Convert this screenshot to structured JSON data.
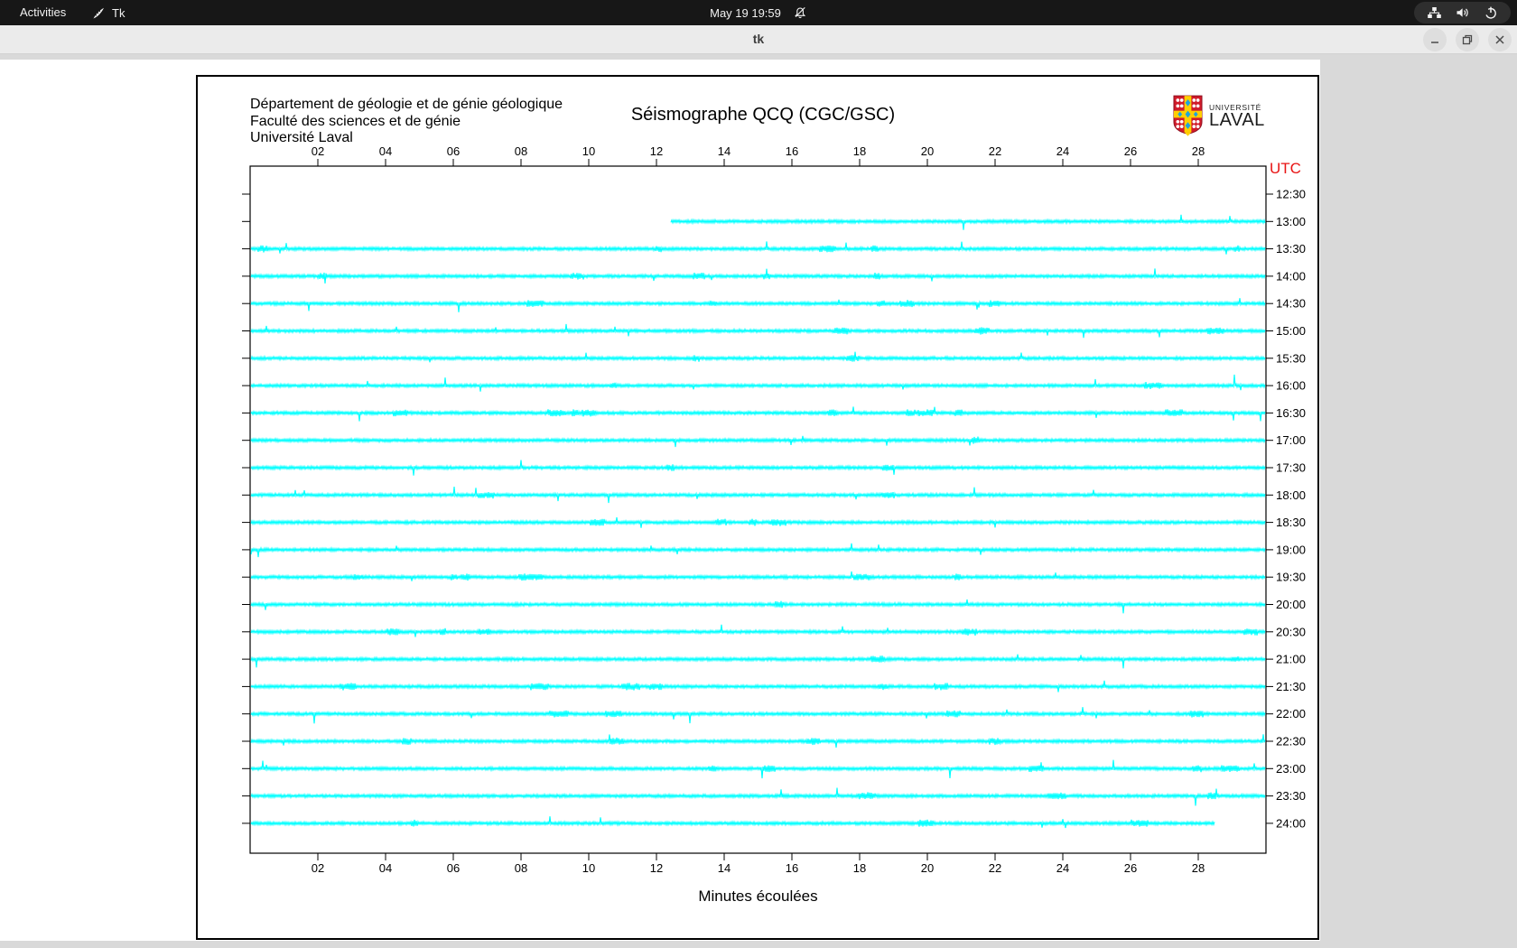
{
  "topbar": {
    "activities_label": "Activities",
    "app_name": "Tk",
    "clock": "May 19 19:59"
  },
  "titlebar": {
    "title": "tk"
  },
  "seismograph": {
    "institution_lines": [
      "Département de géologie et de génie géologique",
      "Faculté des sciences et de génie",
      "Université Laval"
    ],
    "title": "Séismographe QCQ (CGC/GSC)",
    "utc_label": "UTC",
    "utc_color": "#e81414",
    "xlabel": "Minutes écoulées",
    "logo": {
      "line1": "UNIVERSITÉ",
      "line2": "LAVAL",
      "shield_red": "#d01b2a",
      "shield_yellow": "#ffcf00",
      "shield_blue": "#1fa3dc"
    }
  },
  "chart_data": {
    "type": "line",
    "title": "Séismographe QCQ (CGC/GSC)",
    "xlabel": "Minutes écoulées",
    "x_range": [
      0,
      30
    ],
    "x_ticks": [
      "02",
      "04",
      "06",
      "08",
      "10",
      "12",
      "14",
      "16",
      "18",
      "20",
      "22",
      "24",
      "26",
      "28"
    ],
    "y_axis_right_label": "UTC",
    "trace_color": "#00ffff",
    "rows": [
      {
        "utc": "12:30",
        "trace": false
      },
      {
        "utc": "13:00",
        "trace": true,
        "start_min": 12.4,
        "end_min": 30
      },
      {
        "utc": "13:30",
        "trace": true,
        "start_min": 0,
        "end_min": 30
      },
      {
        "utc": "14:00",
        "trace": true,
        "start_min": 0,
        "end_min": 30
      },
      {
        "utc": "14:30",
        "trace": true,
        "start_min": 0,
        "end_min": 30
      },
      {
        "utc": "15:00",
        "trace": true,
        "start_min": 0,
        "end_min": 30
      },
      {
        "utc": "15:30",
        "trace": true,
        "start_min": 0,
        "end_min": 30
      },
      {
        "utc": "16:00",
        "trace": true,
        "start_min": 0,
        "end_min": 30
      },
      {
        "utc": "16:30",
        "trace": true,
        "start_min": 0,
        "end_min": 30
      },
      {
        "utc": "17:00",
        "trace": true,
        "start_min": 0,
        "end_min": 30
      },
      {
        "utc": "17:30",
        "trace": true,
        "start_min": 0,
        "end_min": 30
      },
      {
        "utc": "18:00",
        "trace": true,
        "start_min": 0,
        "end_min": 30
      },
      {
        "utc": "18:30",
        "trace": true,
        "start_min": 0,
        "end_min": 30
      },
      {
        "utc": "19:00",
        "trace": true,
        "start_min": 0,
        "end_min": 30
      },
      {
        "utc": "19:30",
        "trace": true,
        "start_min": 0,
        "end_min": 30
      },
      {
        "utc": "20:00",
        "trace": true,
        "start_min": 0,
        "end_min": 30
      },
      {
        "utc": "20:30",
        "trace": true,
        "start_min": 0,
        "end_min": 30
      },
      {
        "utc": "21:00",
        "trace": true,
        "start_min": 0,
        "end_min": 30
      },
      {
        "utc": "21:30",
        "trace": true,
        "start_min": 0,
        "end_min": 30
      },
      {
        "utc": "22:00",
        "trace": true,
        "start_min": 0,
        "end_min": 30
      },
      {
        "utc": "22:30",
        "trace": true,
        "start_min": 0,
        "end_min": 30
      },
      {
        "utc": "23:00",
        "trace": true,
        "start_min": 0,
        "end_min": 30
      },
      {
        "utc": "23:30",
        "trace": true,
        "start_min": 0,
        "end_min": 30
      },
      {
        "utc": "24:00",
        "trace": true,
        "start_min": 0,
        "end_min": 28.5
      }
    ]
  }
}
